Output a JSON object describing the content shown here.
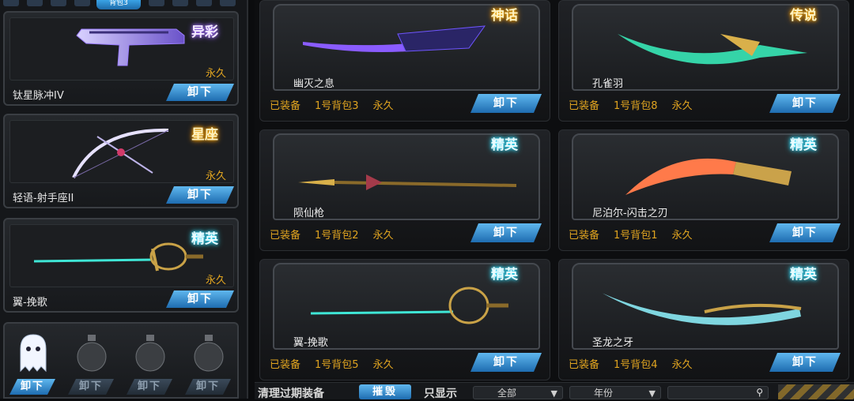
{
  "top_tab": {
    "label": "背包3"
  },
  "colors": {
    "accent_blue": "#2b86d3",
    "gold_text": "#e0a420",
    "card_bg": "#1b1d20"
  },
  "left_cards": [
    {
      "name": "钛星脉冲IV",
      "duration": "永久",
      "badge": "异彩",
      "button": "卸下",
      "icon": "smg-icon"
    },
    {
      "name": "轻语-射手座II",
      "duration": "永久",
      "badge": "星座",
      "button": "卸下",
      "icon": "bow-icon"
    },
    {
      "name": "翼-挽歌",
      "duration": "永久",
      "badge": "精英",
      "button": "卸下",
      "icon": "rapier-icon"
    }
  ],
  "grenade_slots": [
    {
      "icon": "ghost-icon",
      "button": "卸下"
    },
    {
      "icon": "grenade-icon",
      "button": "卸下"
    },
    {
      "icon": "grenade-icon",
      "button": "卸下"
    },
    {
      "icon": "grenade-icon",
      "button": "卸下"
    }
  ],
  "right_cards": [
    {
      "name": "幽灭之息",
      "badge": "神话",
      "equipped": "已装备",
      "bag": "1号背包3",
      "duration": "永久",
      "button": "卸下"
    },
    {
      "name": "孔雀羽",
      "badge": "传说",
      "equipped": "已装备",
      "bag": "1号背包8",
      "duration": "永久",
      "button": "卸下"
    },
    {
      "name": "陨仙枪",
      "badge": "精英",
      "equipped": "已装备",
      "bag": "1号背包2",
      "duration": "永久",
      "button": "卸下"
    },
    {
      "name": "尼泊尔-闪击之刃",
      "badge": "精英",
      "equipped": "已装备",
      "bag": "1号背包1",
      "duration": "永久",
      "button": "卸下"
    },
    {
      "name": "翼-挽歌",
      "badge": "精英",
      "equipped": "已装备",
      "bag": "1号背包5",
      "duration": "永久",
      "button": "卸下"
    },
    {
      "name": "圣龙之牙",
      "badge": "精英",
      "equipped": "已装备",
      "bag": "1号背包4",
      "duration": "永久",
      "button": "卸下"
    }
  ],
  "bottom_bar": {
    "clear_label": "清理过期装备",
    "destroy_button": "摧毁",
    "show_only_label": "只显示",
    "filter_all": "全部",
    "filter_year": "年份",
    "search_icon": "search-icon"
  }
}
